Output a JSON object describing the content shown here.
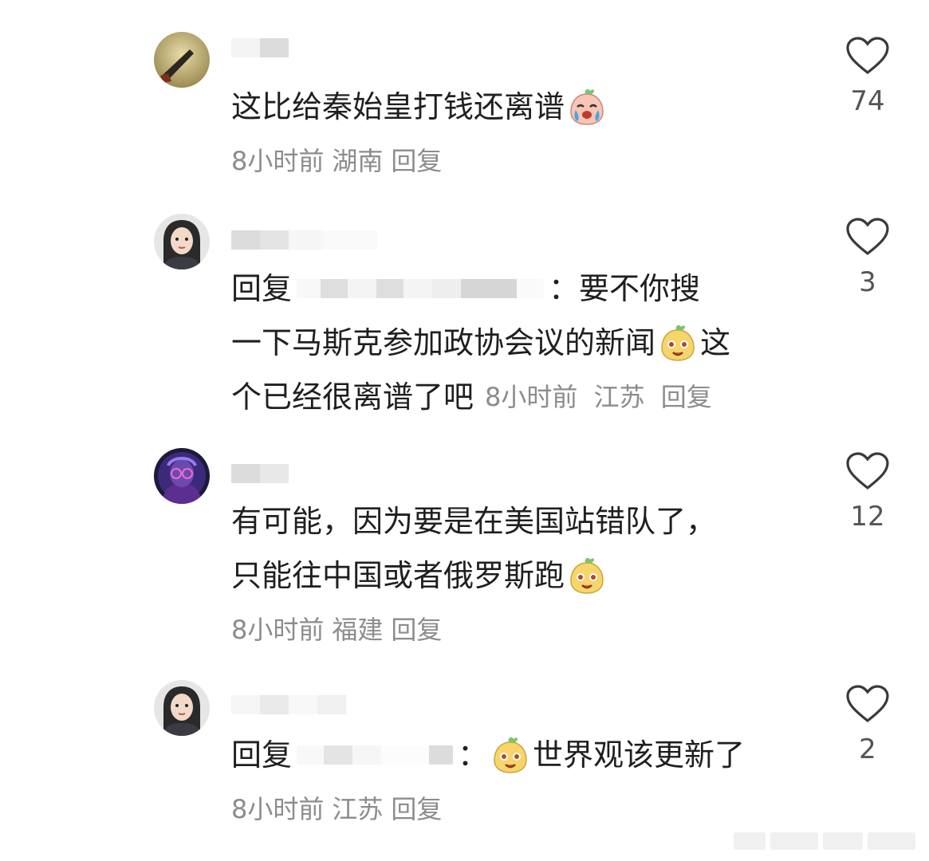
{
  "comments": [
    {
      "text": "这比给秦始皇打钱还离谱",
      "emoji": "crying-face-emoji",
      "meta": {
        "time": "8小时前",
        "location": "湖南",
        "reply": "回复"
      },
      "likes": "74"
    },
    {
      "reply_prefix": "回复",
      "colon": "：",
      "line1": "要不你搜",
      "line2": "一下马斯克参加政协会议的新闻",
      "line2_tail": "这",
      "line3": "个已经很离谱了吧",
      "emoji": "smiling-face-emoji",
      "meta": {
        "time": "8小时前",
        "location": "江苏",
        "reply": "回复"
      },
      "likes": "3"
    },
    {
      "line1": "有可能，因为要是在美国站错队了，",
      "line2": "只能往中国或者俄罗斯跑",
      "emoji": "smiling-face-emoji",
      "meta": {
        "time": "8小时前",
        "location": "福建",
        "reply": "回复"
      },
      "likes": "12"
    },
    {
      "reply_prefix": "回复",
      "colon": "：",
      "text": "世界观该更新了",
      "emoji": "smiling-face-emoji",
      "meta": {
        "time": "8小时前",
        "location": "江苏",
        "reply": "回复"
      },
      "likes": "2"
    }
  ],
  "colors": {
    "text": "#1f1f1f",
    "meta": "#8c8c8c",
    "blur": "#d9d9d9"
  },
  "icons": {
    "like": "heart-outline-icon"
  }
}
